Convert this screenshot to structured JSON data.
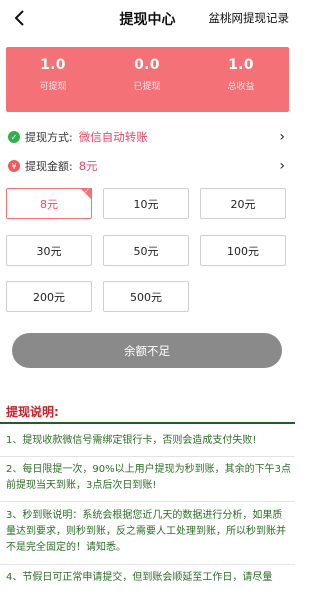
{
  "header": {
    "title": "提现中心",
    "record_label": "盆桃网提现记录"
  },
  "summary": [
    {
      "value": "1.0",
      "label": "可提现"
    },
    {
      "value": "0.0",
      "label": "已提现"
    },
    {
      "value": "1.0",
      "label": "总收益"
    }
  ],
  "method": {
    "label": "提现方式:",
    "value": "微信自动转账"
  },
  "amount": {
    "label": "提现金额:",
    "value": "8元"
  },
  "amount_options": [
    "8元",
    "10元",
    "20元",
    "30元",
    "50元",
    "100元",
    "200元",
    "500元"
  ],
  "selected_option": "8元",
  "submit_label": "余额不足",
  "notes": {
    "title": "提现说明:",
    "items": [
      "1、提现收款微信号需绑定银行卡，否则会造成支付失败!",
      "2、每日限提一次，90%以上用户提现为秒到账，其余的下午3点前提现当天到账，3点后次日到账!",
      "3、秒到账说明：系统会根据您近几天的数据进行分析，如果质量达到要求，则秒到账，反之需要人工处理到账，所以秒到账并不是完全固定的！请知悉。",
      "4、节假日可正常申请提交，但到账会顺延至工作日，请尽量"
    ]
  },
  "colors": {
    "accent": "#f47178",
    "highlight": "#e74b68",
    "notes_text": "#2d6d28",
    "notes_title": "#c8222a",
    "button_disabled": "#8a8a8a"
  }
}
